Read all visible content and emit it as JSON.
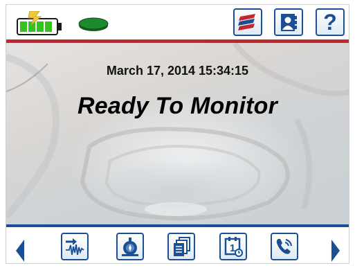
{
  "header": {
    "battery_icon": "battery-charging-icon",
    "storage_icon": "storage-disk-icon",
    "buttons": [
      {
        "name": "flag-button",
        "icon": "flag-icon"
      },
      {
        "name": "contact-button",
        "icon": "contact-card-icon"
      },
      {
        "name": "help-button",
        "icon": "help-icon",
        "glyph": "?"
      }
    ]
  },
  "main": {
    "datetime": "March 17, 2014 15:34:15",
    "status": "Ready To Monitor"
  },
  "footer": {
    "buttons": [
      {
        "name": "waveform-button",
        "icon": "waveform-icon"
      },
      {
        "name": "sensor-button",
        "icon": "sensor-icon"
      },
      {
        "name": "documents-button",
        "icon": "documents-icon"
      },
      {
        "name": "calendar-button",
        "icon": "calendar-clock-icon",
        "glyph": "1"
      },
      {
        "name": "phone-button",
        "icon": "phone-icon"
      }
    ]
  },
  "colors": {
    "accent_red": "#c4262e",
    "accent_blue": "#1a4f93",
    "battery_green": "#34c21d",
    "disk_green": "#1e8a2e"
  }
}
